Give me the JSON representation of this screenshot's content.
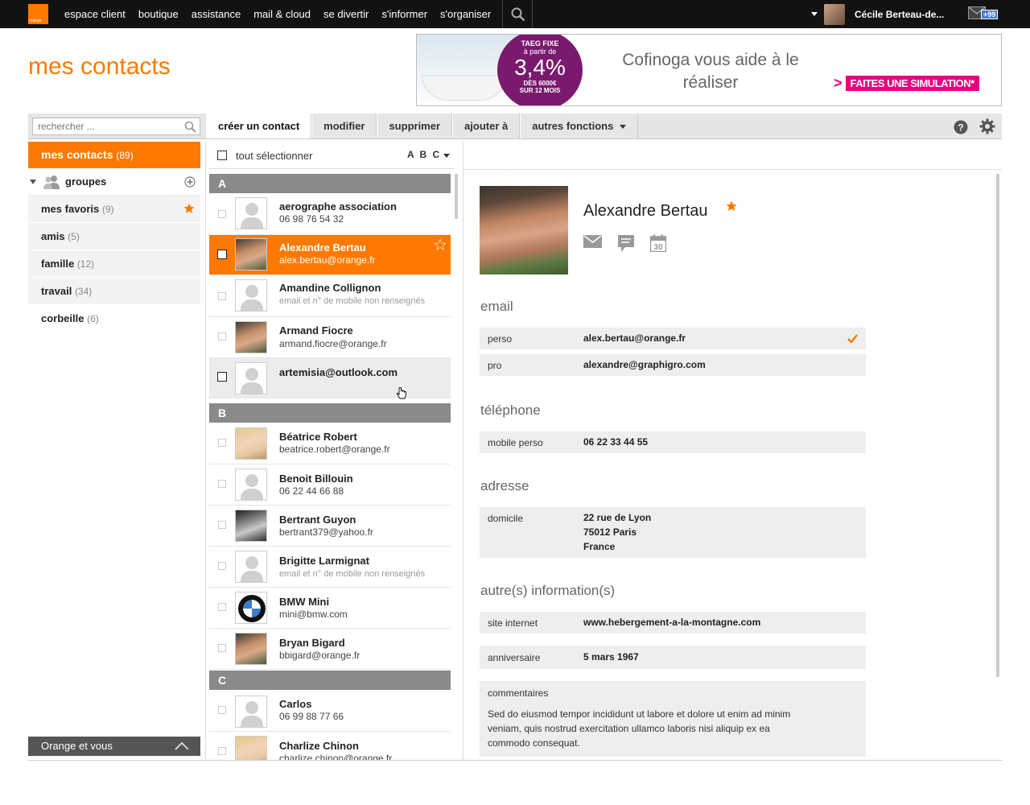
{
  "brand": {
    "logo_text": "orange",
    "accent": "#ff7900"
  },
  "nav": {
    "items": [
      "espace client",
      "boutique",
      "assistance",
      "mail & cloud",
      "se divertir",
      "s'informer",
      "s'organiser"
    ],
    "user_name": "Cécile Berteau-de...",
    "mail_badge": "+99"
  },
  "page_title": "mes contacts",
  "ad": {
    "badge_l1": "TAEG FIXE",
    "badge_l2": "à partir de",
    "badge_rate": "3,4%",
    "badge_l4": "DÈS 6000€",
    "badge_l5": "SUR 12 MOIS",
    "text": "Cofinoga vous aide à le réaliser",
    "cta": "FAITES UNE SIMULATION*",
    "cta_arrow": ">"
  },
  "toolbar": {
    "search_placeholder": "rechercher ...",
    "create": "créer un contact",
    "edit": "modifier",
    "delete": "supprimer",
    "add_to": "ajouter à",
    "other": "autres fonctions"
  },
  "sidebar": {
    "all_label": "mes contacts",
    "all_count": "(89)",
    "groups_label": "groupes",
    "items": [
      {
        "label": "mes favoris",
        "count": "(9)"
      },
      {
        "label": "amis",
        "count": "(5)"
      },
      {
        "label": "famille",
        "count": "(12)"
      },
      {
        "label": "travail",
        "count": "(34)"
      },
      {
        "label": "corbeille",
        "count": "(6)"
      }
    ],
    "footer": "Orange et vous"
  },
  "list": {
    "select_all": "tout sélectionner",
    "sort": "A B C",
    "letters": [
      "A",
      "B",
      "C"
    ],
    "contacts": [
      {
        "name": "aerographe association",
        "sub": "06 98 76 54 32"
      },
      {
        "name": "Alexandre Bertau",
        "sub": "alex.bertau@orange.fr"
      },
      {
        "name": "Amandine Collignon",
        "sub": "email et n° de mobile non renseignés"
      },
      {
        "name": "Armand Fiocre",
        "sub": "armand.fiocre@orange.fr"
      },
      {
        "name": "artemisia@outlook.com",
        "sub": ""
      },
      {
        "name": "Béatrice Robert",
        "sub": "beatrice.robert@orange.fr"
      },
      {
        "name": "Benoit Billouin",
        "sub": "06 22 44 66 88"
      },
      {
        "name": "Bertrant Guyon",
        "sub": "bertrant379@yahoo.fr"
      },
      {
        "name": "Brigitte Larmignat",
        "sub": "email et n° de mobile non renseignés"
      },
      {
        "name": "BMW Mini",
        "sub": "mini@bmw.com"
      },
      {
        "name": "Bryan Bigard",
        "sub": "bbigard@orange.fr"
      },
      {
        "name": "Carlos",
        "sub": "06 99 88 77 66"
      },
      {
        "name": "Charlize Chinon",
        "sub": "charlize.chinon@orange.fr"
      }
    ]
  },
  "detail": {
    "name": "Alexandre Bertau",
    "sections": {
      "email": "email",
      "phone": "téléphone",
      "address": "adresse",
      "other": "autre(s) information(s)"
    },
    "email_perso_label": "perso",
    "email_perso": "alex.bertau@orange.fr",
    "email_pro_label": "pro",
    "email_pro": "alexandre@graphigro.com",
    "mobile_label": "mobile perso",
    "mobile": "06 22 33 44 55",
    "address_label": "domicile",
    "address_l1": "22 rue de Lyon",
    "address_l2": "75012 Paris",
    "address_l3": "France",
    "website_label": "site internet",
    "website": "www.hebergement-a-la-montagne.com",
    "birthday_label": "anniversaire",
    "birthday": "5 mars 1967",
    "comments_label": "commentaires",
    "comments": "Sed do eiusmod tempor incididunt ut labore et dolore ut enim ad minim veniam, quis nostrud exercitation ullamco laboris nisi aliquip ex ea commodo consequat.",
    "calendar_day": "30"
  }
}
